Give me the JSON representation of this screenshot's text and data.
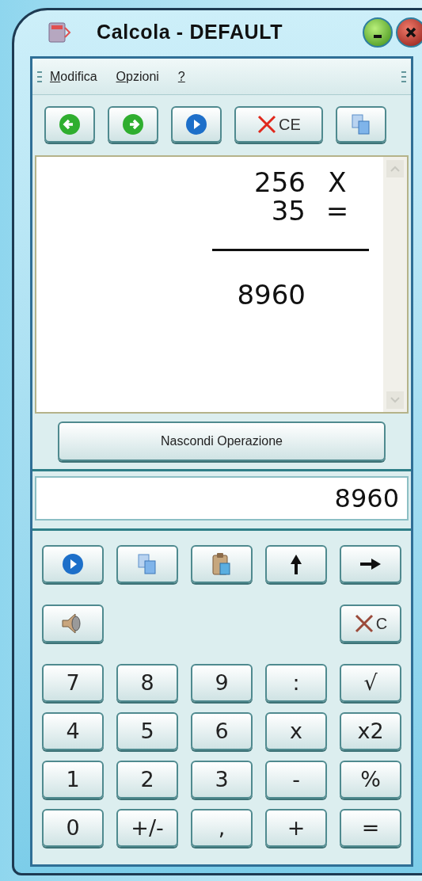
{
  "window": {
    "title": "Calcola - DEFAULT"
  },
  "menu": [
    {
      "label": "Modifica"
    },
    {
      "label": "Opzioni"
    },
    {
      "label": "?"
    }
  ],
  "toolbar": {
    "clear_entry_label": "CE"
  },
  "display": {
    "lines": [
      {
        "operand": "256",
        "operator": "X"
      },
      {
        "operand": "35",
        "operator": "="
      }
    ],
    "result": "8960"
  },
  "toggle_button": "Nascondi Operazione",
  "input": {
    "value": "8960"
  },
  "function_keys": {
    "clear_label": "C"
  },
  "keypad": [
    [
      "7",
      "8",
      "9",
      ":",
      "√"
    ],
    [
      "4",
      "5",
      "6",
      "x",
      "x2"
    ],
    [
      "1",
      "2",
      "3",
      "-",
      "%"
    ],
    [
      "0",
      "+/-",
      ",",
      "+",
      "="
    ]
  ]
}
